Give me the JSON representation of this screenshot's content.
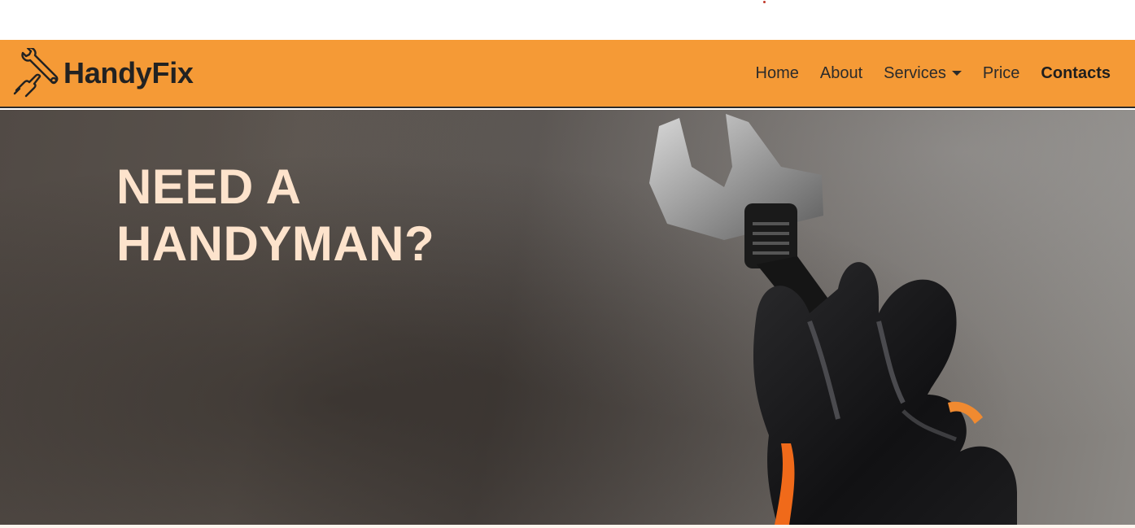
{
  "colors": {
    "nav_background": "#f59a36",
    "hero_title": "#fde3cc",
    "accent_dot": "#c0392b"
  },
  "brand": {
    "name": "HandyFix",
    "logo_icon": "hand-wrench-icon"
  },
  "nav": {
    "items": [
      {
        "label": "Home",
        "bold": false
      },
      {
        "label": "About",
        "bold": false
      },
      {
        "label": "Services",
        "bold": false,
        "dropdown": true
      },
      {
        "label": "Price",
        "bold": false
      },
      {
        "label": "Contacts",
        "bold": true
      }
    ]
  },
  "hero": {
    "title": "NEED A\nHANDYMAN?",
    "image_icon": "gloved-hand-wrench-icon"
  }
}
